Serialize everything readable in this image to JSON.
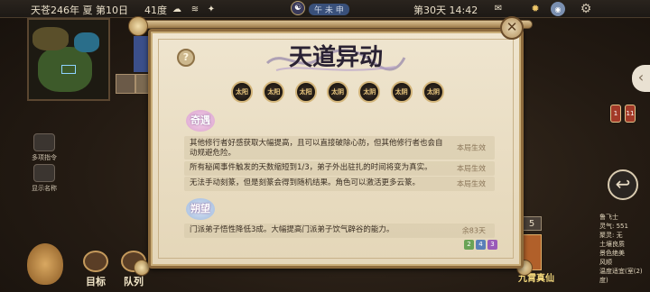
{
  "status_bar": {
    "date": "天苍246年 夏 第10日",
    "temperature": "41度",
    "season_seal": "午 未 申",
    "time": "第30天 14:42"
  },
  "left_menu": {
    "item1": "多项指令",
    "item2": "显示名称"
  },
  "bottom_nav": {
    "goal": "目标",
    "team": "队列"
  },
  "dialog": {
    "title": "天道异动",
    "badges": [
      "太阳",
      "太阳",
      "太阳",
      "太阴",
      "太阴",
      "太阴",
      "太阴"
    ],
    "section1_tag": "奇遇",
    "section2_tag": "朔望",
    "rules": [
      {
        "text": "其他修行者好感获取大幅提高，且可以直接破除心防，但其他修行者也会自动规避危险。",
        "status": "本局生效"
      },
      {
        "text": "所有秘闻事件触发的天数缩短到1/3，弟子外出驻扎的时间将变为真实。",
        "status": "本局生效"
      },
      {
        "text": "无法手动刻篆，但是刻篆会得到随机结果。角色可以激活更多云篆。",
        "status": "本局生效"
      }
    ],
    "lunar_rule": {
      "text": "门派弟子悟性降低3成。大幅提高门派弟子饮气辟谷的能力。",
      "status": "余83天"
    },
    "chips": [
      "2",
      "4",
      "3"
    ]
  },
  "right_panel": {
    "lines": [
      "鲁飞士",
      "灵气: 551",
      "聚灵: 无",
      "土壤良质",
      "景色绝美",
      "风顺",
      "温度适宜(室(2)度)"
    ],
    "footer": "九霄真仙",
    "pills": [
      "1",
      "11"
    ],
    "count": "5"
  },
  "colors": {
    "accent_gold": "#d3b57a",
    "panel_bg": "#efe5cf",
    "tag_pink": "#e8b7d8",
    "tag_blue": "#b7cde8"
  }
}
